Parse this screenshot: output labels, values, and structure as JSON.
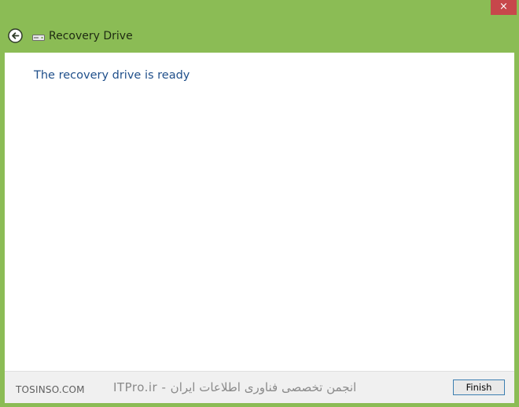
{
  "window": {
    "title": "Recovery Drive",
    "close_glyph": "×",
    "accent_color": "#8bbc55",
    "close_color": "#c7474b"
  },
  "icons": {
    "back": "back-arrow-icon",
    "drive": "drive-icon"
  },
  "content": {
    "heading": "The recovery drive is ready",
    "heading_color": "#1f4f8a"
  },
  "footer": {
    "watermark_left": "TOSINSO.COM",
    "watermark_right": "ITPro.ir - انجمن تخصصی فناوری اطلاعات ایران",
    "finish_label": "Finish"
  }
}
